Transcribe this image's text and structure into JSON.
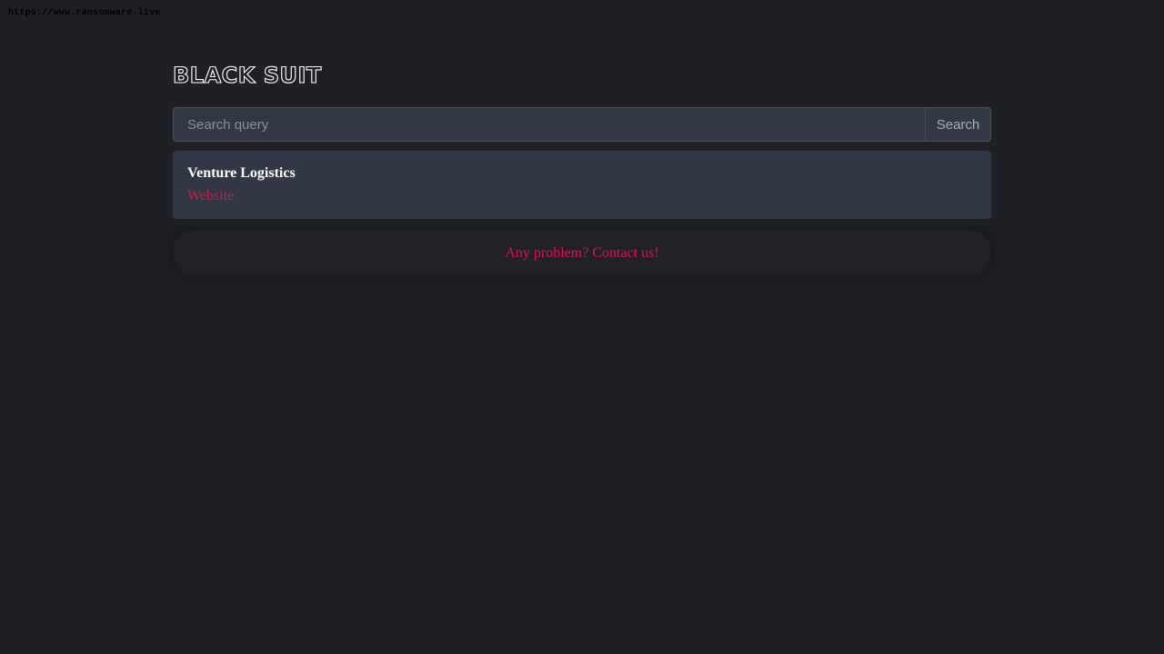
{
  "watermark": "https://www.ransomware.live",
  "logo": "BLACK SUIT",
  "search": {
    "placeholder": "Search query",
    "value": "",
    "button_label": "Search"
  },
  "results": [
    {
      "title": "Venture Logistics",
      "link_label": "Website"
    }
  ],
  "footer": {
    "contact_label": "Any problem? Contact us!"
  },
  "colors": {
    "background": "#1e2025",
    "card": "#323745",
    "accent": "#e0124f",
    "text": "#ffffff"
  }
}
